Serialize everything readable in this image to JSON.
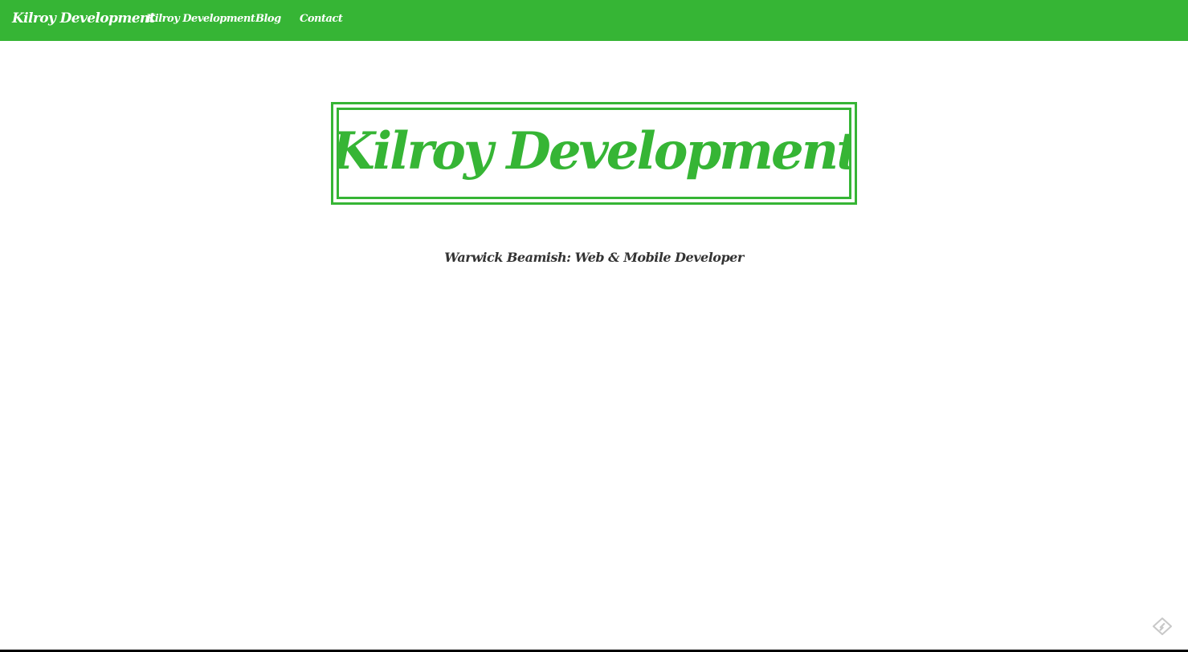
{
  "colors": {
    "accent": "#36b535",
    "navbar_text": "#ffffff",
    "tagline_text": "#333333",
    "background": "#ffffff"
  },
  "navbar": {
    "brand": "Kilroy Development",
    "links": [
      {
        "label": "Kilroy Development"
      },
      {
        "label": "Blog"
      },
      {
        "label": "Contact"
      }
    ]
  },
  "hero": {
    "logo_text": "Kilroy Development",
    "tagline": "Warwick Beamish: Web & Mobile Developer"
  },
  "corner_icon": {
    "icon": "feedly-icon"
  }
}
